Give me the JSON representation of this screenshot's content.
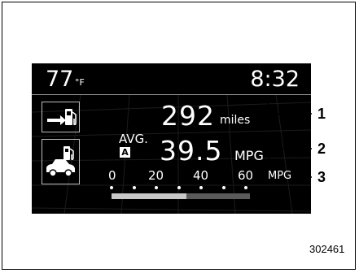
{
  "display": {
    "temperature": "77",
    "temperature_unit": "°F",
    "clock": "8:32",
    "range_value": "292",
    "range_unit": "miles",
    "avg_label": "AVG.",
    "avg_badge": "A",
    "avg_mpg_value": "39.5",
    "avg_mpg_unit": "MPG",
    "scale_labels": [
      "0",
      "20",
      "40",
      "60"
    ],
    "scale_unit": "MPG",
    "gauge_fraction": 0.54
  },
  "icons": {
    "range_icon": "arrow-to-fuel-pump-icon",
    "fuel_economy_icon": "car-and-fuel-pump-icon"
  },
  "callouts": [
    "1",
    "2",
    "3"
  ],
  "figure_number": "302461",
  "colors": {
    "screen_background": "#000000",
    "text": "#ffffff",
    "gauge_fill": "#c8c8c8",
    "gauge_track": "#5a5a5a"
  }
}
